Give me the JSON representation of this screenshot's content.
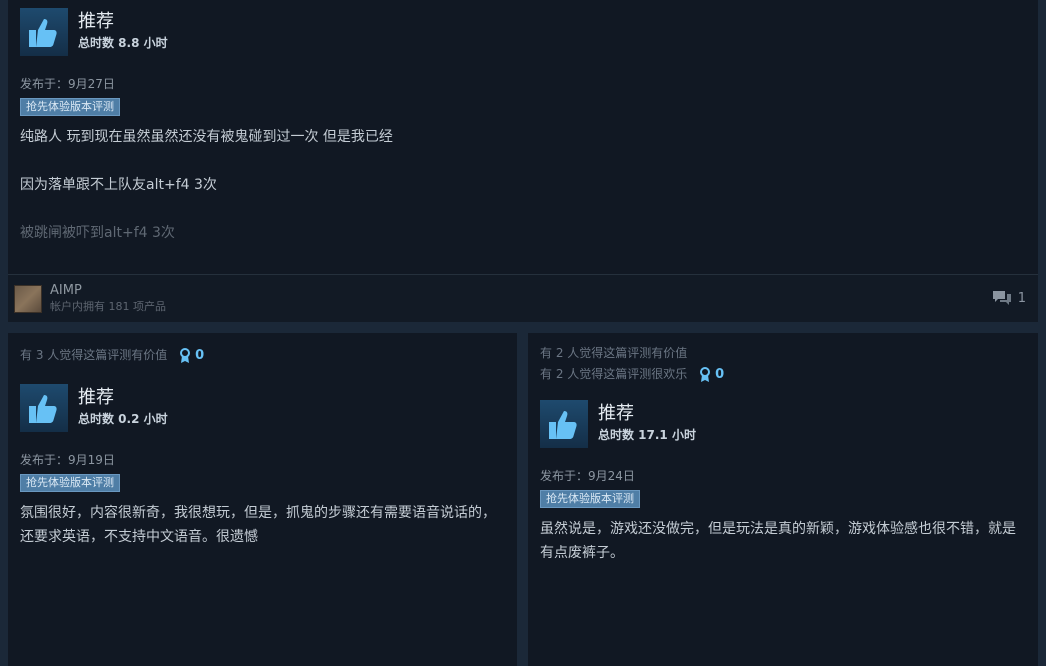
{
  "top_review": {
    "verdict": "推荐",
    "hours": "总时数 8.8 小时",
    "posted": "发布于：9月27日",
    "badge": "抢先体验版本评测",
    "paragraphs": [
      "纯路人 玩到现在虽然虽然还没有被鬼碰到过一次 但是我已经",
      "因为落单跟不上队友alt+f4 3次",
      "被跳闸被吓到alt+f4 3次"
    ],
    "author": {
      "name": "AIMP",
      "products": "帐户内拥有 181 项产品"
    },
    "comment_count": "1"
  },
  "left_review": {
    "helpful": "有 3 人觉得这篇评测有价值",
    "award_count": "0",
    "verdict": "推荐",
    "hours": "总时数 0.2 小时",
    "posted": "发布于：9月19日",
    "badge": "抢先体验版本评测",
    "text": "氛围很好，内容很新奇，我很想玩，但是，抓鬼的步骤还有需要语音说话的，还要求英语，不支持中文语音。很遗憾"
  },
  "right_review": {
    "helpful": "有 2 人觉得这篇评测有价值",
    "funny": "有 2 人觉得这篇评测很欢乐",
    "award_count": "0",
    "verdict": "推荐",
    "hours": "总时数 17.1 小时",
    "posted": "发布于：9月24日",
    "badge": "抢先体验版本评测",
    "text": "虽然说是，游戏还没做完，但是玩法是真的新颖，游戏体验感也很不错，就是有点废裤子。"
  },
  "icons": {
    "thumb": "thumbs-up-icon",
    "award": "award-ribbon-icon",
    "comment": "comment-bubble-icon"
  },
  "colors": {
    "background": "#1b2838",
    "card": "#111823",
    "badge": "#4f7ea6",
    "award": "#67c1f5"
  }
}
